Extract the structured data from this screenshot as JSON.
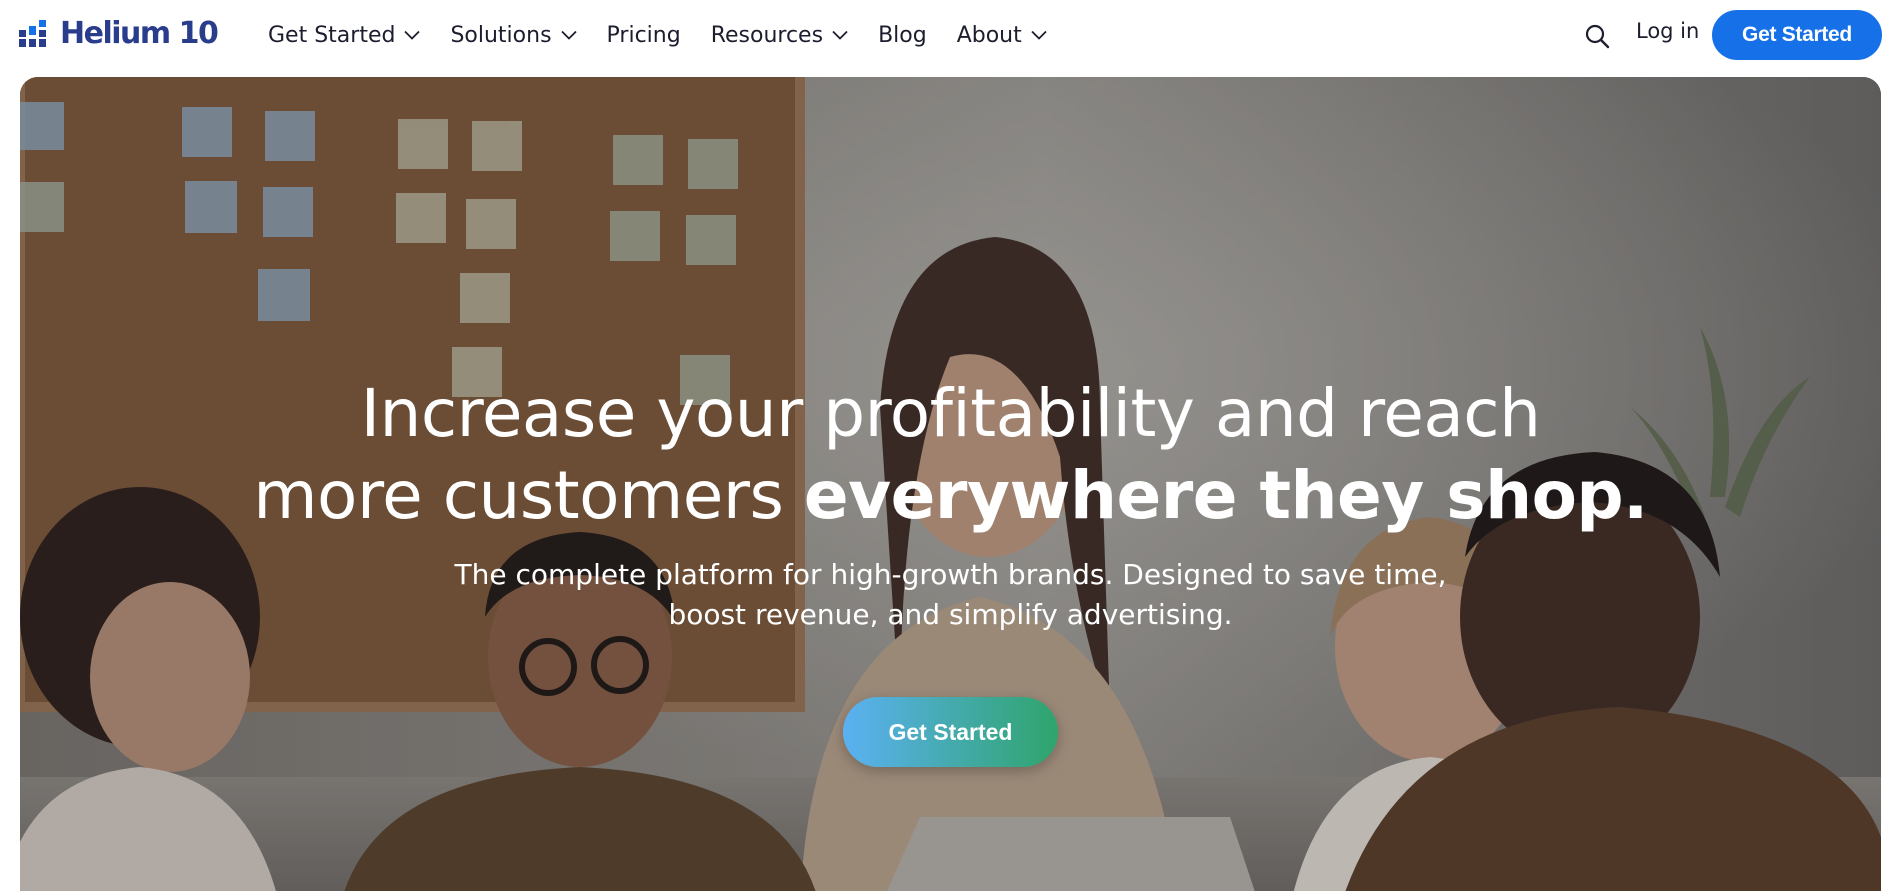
{
  "brand": {
    "name": "Helium 10",
    "color": "#2a3c8c",
    "logo_icon": "bar-chart-logo-icon"
  },
  "nav": {
    "items": [
      {
        "label": "Get Started",
        "dropdown": true
      },
      {
        "label": "Solutions",
        "dropdown": true
      },
      {
        "label": "Pricing",
        "dropdown": false
      },
      {
        "label": "Resources",
        "dropdown": true
      },
      {
        "label": "Blog",
        "dropdown": false
      },
      {
        "label": "About",
        "dropdown": true
      }
    ],
    "search_icon": "search-icon",
    "login_label": "Log in",
    "cta_label": "Get Started",
    "cta_color": "#1671e8"
  },
  "hero": {
    "title_line1": "Increase your profitability and reach",
    "title_line2_regular": "more customers ",
    "title_line2_bold": "everywhere they shop.",
    "subtitle_line1": "The complete platform for high-growth brands. Designed to save time,",
    "subtitle_line2": "boost revenue, and simplify advertising.",
    "cta_label": "Get Started",
    "cta_gradient": [
      "#5bb1f2",
      "#2fa46b"
    ]
  }
}
